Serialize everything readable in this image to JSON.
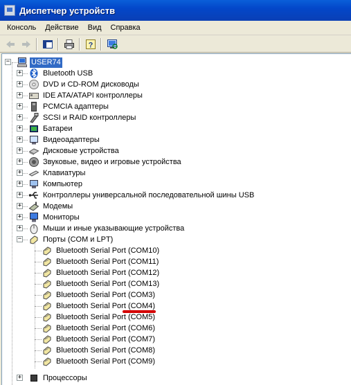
{
  "window": {
    "title": "Диспетчер устройств"
  },
  "menu": [
    {
      "label": "Консоль"
    },
    {
      "label": "Действие"
    },
    {
      "label": "Вид"
    },
    {
      "label": "Справка"
    }
  ],
  "toolbar": {
    "buttons": [
      {
        "icon": "back-arrow-icon",
        "enabled": false
      },
      {
        "icon": "forward-arrow-icon",
        "enabled": false
      },
      {
        "icon": "show-hide-tree-icon",
        "enabled": true
      },
      {
        "icon": "print-icon",
        "enabled": true
      },
      {
        "icon": "help-properties-icon",
        "enabled": true
      },
      {
        "icon": "scan-hardware-icon",
        "enabled": true
      }
    ]
  },
  "tree": {
    "root": {
      "label": "USER74",
      "expanded": true,
      "selected": true,
      "icon": "computer-icon"
    },
    "categories": [
      {
        "label": "Bluetooth USB",
        "expanded": false,
        "icon": "bluetooth-icon"
      },
      {
        "label": "DVD и CD-ROM дисководы",
        "expanded": false,
        "icon": "cdrom-icon"
      },
      {
        "label": "IDE ATA/ATAPI контроллеры",
        "expanded": false,
        "icon": "ide-controller-icon"
      },
      {
        "label": "PCMCIA адаптеры",
        "expanded": false,
        "icon": "pcmcia-icon"
      },
      {
        "label": "SCSI и RAID контроллеры",
        "expanded": false,
        "icon": "scsi-icon"
      },
      {
        "label": "Батареи",
        "expanded": false,
        "icon": "battery-icon"
      },
      {
        "label": "Видеоадаптеры",
        "expanded": false,
        "icon": "display-adapter-icon"
      },
      {
        "label": "Дисковые устройства",
        "expanded": false,
        "icon": "disk-drive-icon"
      },
      {
        "label": "Звуковые, видео и игровые устройства",
        "expanded": false,
        "icon": "sound-icon"
      },
      {
        "label": "Клавиатуры",
        "expanded": false,
        "icon": "keyboard-icon"
      },
      {
        "label": "Компьютер",
        "expanded": false,
        "icon": "computer-small-icon"
      },
      {
        "label": "Контроллеры универсальной последовательной шины USB",
        "expanded": false,
        "icon": "usb-icon"
      },
      {
        "label": "Модемы",
        "expanded": false,
        "icon": "modem-icon"
      },
      {
        "label": "Мониторы",
        "expanded": false,
        "icon": "monitor-icon"
      },
      {
        "label": "Мыши и иные указывающие устройства",
        "expanded": false,
        "icon": "mouse-icon"
      },
      {
        "label": "Порты (COM и LPT)",
        "expanded": true,
        "icon": "port-icon"
      }
    ],
    "ports": [
      {
        "label": "Bluetooth Serial Port (COM10)"
      },
      {
        "label": "Bluetooth Serial Port (COM11)"
      },
      {
        "label": "Bluetooth Serial Port (COM12)"
      },
      {
        "label": "Bluetooth Serial Port (COM13)"
      },
      {
        "label": "Bluetooth Serial Port (COM3)"
      },
      {
        "label": "Bluetooth Serial Port (COM4)",
        "highlighted": true
      },
      {
        "label": "Bluetooth Serial Port (COM5)"
      },
      {
        "label": "Bluetooth Serial Port (COM6)"
      },
      {
        "label": "Bluetooth Serial Port (COM7)"
      },
      {
        "label": "Bluetooth Serial Port (COM8)"
      },
      {
        "label": "Bluetooth Serial Port (COM9)"
      }
    ],
    "next_category": {
      "label": "Процессоры",
      "expanded": false,
      "icon": "processor-icon"
    }
  },
  "colors": {
    "selection": "#316ac5",
    "annotation_underline": "#d40000",
    "titlebar": "#0a5fd9"
  }
}
